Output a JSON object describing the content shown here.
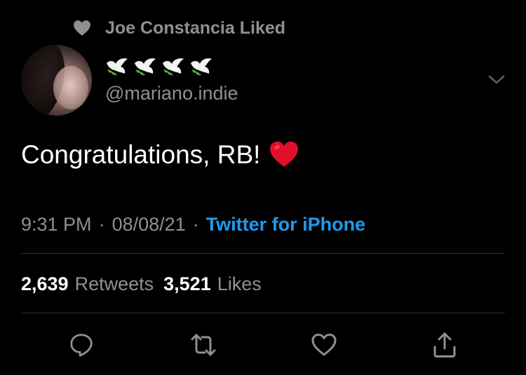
{
  "social_context": {
    "text": "Joe Constancia Liked",
    "icon": "heart-icon"
  },
  "author": {
    "display_name_emoji": [
      "dove-emoji",
      "dove-emoji",
      "dove-emoji",
      "dove-emoji"
    ],
    "handle": "@mariano.indie"
  },
  "tweet": {
    "text": "Congratulations, RB!",
    "emoji": "red-heart-emoji"
  },
  "meta": {
    "time": "9:31 PM",
    "separator": "·",
    "date": "08/08/21",
    "source": "Twitter for iPhone"
  },
  "stats": {
    "retweets_count": "2,639",
    "retweets_label": "Retweets",
    "likes_count": "3,521",
    "likes_label": "Likes"
  },
  "actions": [
    "reply-icon",
    "retweet-icon",
    "like-icon",
    "share-icon"
  ],
  "colors": {
    "background": "#000000",
    "primary_text": "#ffffff",
    "secondary_text": "#8e9094",
    "link": "#1d9bf0",
    "divider": "#2f3336",
    "heart_red": "#e0102a"
  }
}
